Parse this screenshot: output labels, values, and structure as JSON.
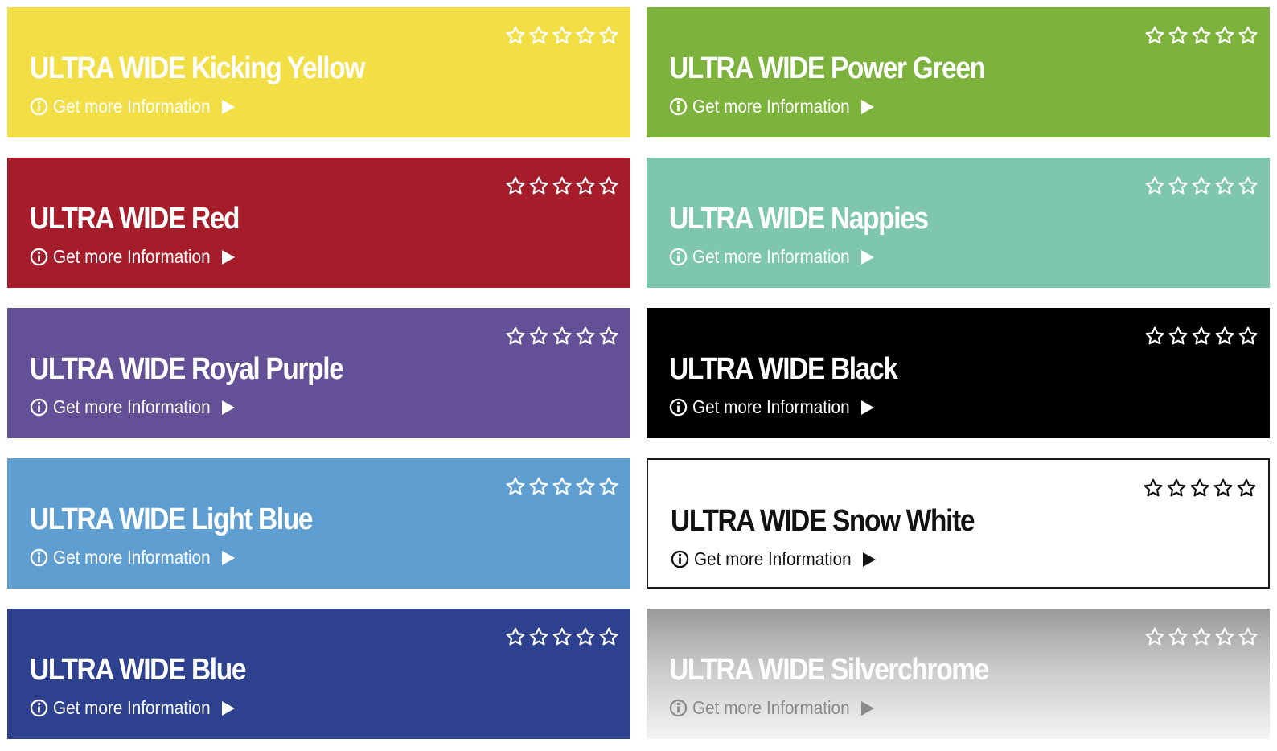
{
  "rating_max": 5,
  "products": [
    {
      "title": "ULTRA WIDE Kicking Yellow",
      "link": "Get more Information",
      "rating": 0,
      "bg": "#f2df46",
      "fg": "#ffffff",
      "star": "#ffffff"
    },
    {
      "title": "ULTRA WIDE Power Green",
      "link": "Get more Information",
      "rating": 0,
      "bg": "#7db23d",
      "fg": "#ffffff",
      "star": "#ffffff"
    },
    {
      "title": "ULTRA WIDE Red",
      "link": "Get more Information",
      "rating": 0,
      "bg": "#a51c2a",
      "fg": "#ffffff",
      "star": "#ffffff"
    },
    {
      "title": "ULTRA WIDE Nappies",
      "link": "Get more Information",
      "rating": 0,
      "bg": "#7ec6ae",
      "fg": "#ffffff",
      "star": "#ffffff"
    },
    {
      "title": "ULTRA WIDE Royal Purple",
      "link": "Get more Information",
      "rating": 0,
      "bg": "#635097",
      "fg": "#ffffff",
      "star": "#ffffff"
    },
    {
      "title": "ULTRA WIDE Black",
      "link": "Get more Information",
      "rating": 0,
      "bg": "#000000",
      "fg": "#ffffff",
      "star": "#ffffff"
    },
    {
      "title": "ULTRA WIDE Light Blue",
      "link": "Get more Information",
      "rating": 0,
      "bg": "#5f9ed1",
      "fg": "#ffffff",
      "star": "#ffffff"
    },
    {
      "title": "ULTRA WIDE Snow White",
      "link": "Get more Information",
      "rating": 0,
      "bg": "#ffffff",
      "fg": "#111111",
      "star": "#111111",
      "border": "#1a1a1a"
    },
    {
      "title": "ULTRA WIDE Blue",
      "link": "Get more Information",
      "rating": 0,
      "bg": "#2d418f",
      "fg": "#ffffff",
      "star": "#ffffff"
    },
    {
      "title": "ULTRA WIDE Silverchrome",
      "link": "Get more Information",
      "rating": 0,
      "bg": "linear-gradient(to bottom, #9a9a9a 0%, #c9c9c9 45%, #f4f4f4 100%)",
      "fg": "#ffffff",
      "star": "#ffffff",
      "link_fg": "#8a8a8a"
    }
  ]
}
